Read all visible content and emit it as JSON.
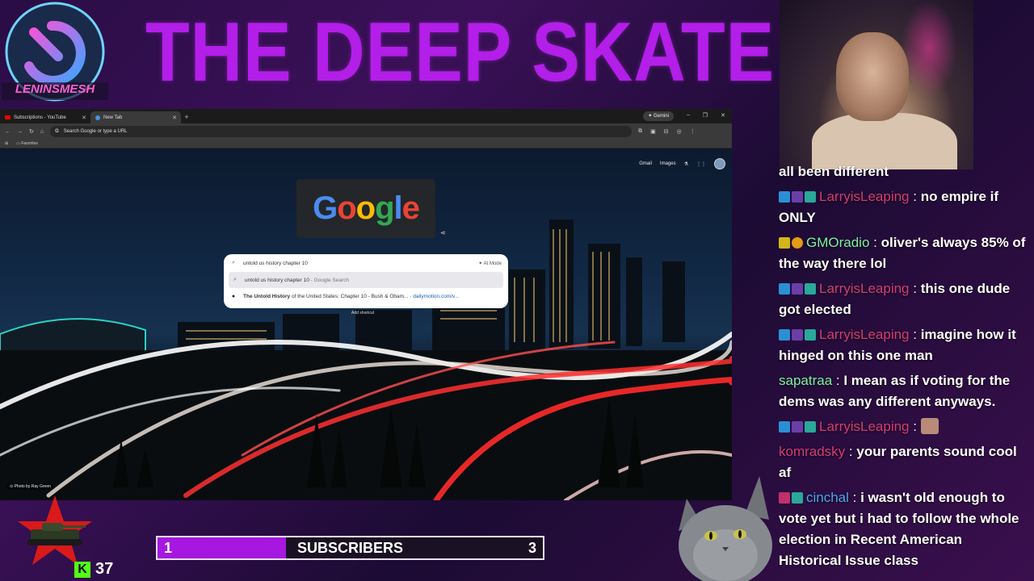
{
  "overlay": {
    "logo_text": "LENINSMESH",
    "stream_title": "THE DEEP SKATE",
    "kick_icon": "K",
    "kick_count": "37",
    "subscribers": {
      "current": "1",
      "label": "SUBSCRIBERS",
      "goal": "3",
      "progress_fraction": 0.333,
      "fill_color": "#a617e0"
    },
    "accent_color": "#b31ee8"
  },
  "browser": {
    "tabs": [
      {
        "label": "Subscriptions - YouTube",
        "favicon_color": "#ff0000",
        "active": false
      },
      {
        "label": "New Tab",
        "favicon_color": "#4a90e2",
        "active": true
      }
    ],
    "new_tab_glyph": "+",
    "gemini_label": "Gemini",
    "window_controls": {
      "minimize": "–",
      "maximize": "❐",
      "close": "✕"
    },
    "nav": {
      "back": "←",
      "forward": "→",
      "reload": "↻",
      "home": "⌂"
    },
    "omnibox_placeholder": "Search Google or type a URL",
    "bookmarks": {
      "apps_glyph": "⊞",
      "favorites": "Favorites"
    }
  },
  "ntp": {
    "links": {
      "gmail": "Gmail",
      "images": "Images"
    },
    "doodle_text": "Google",
    "search": {
      "query": "untold us history chapter 10",
      "ai_mode": "AI Mode",
      "suggestion_query": "untold us history chapter 10",
      "suggestion_suffix": "Google Search",
      "result_title_bold": "The Untold History",
      "result_title_rest": "of the United States: Chapter 10 - Bush & Obam...",
      "result_url": "dailymotion.com/v..."
    },
    "add_shortcut": "Add shortcut",
    "photo_credit": "Photo by Ray Green"
  },
  "chat": {
    "messages": [
      {
        "user": "",
        "user_color": "#ffffff",
        "text": "all been different",
        "badges": []
      },
      {
        "user": "LarryisLeaping",
        "user_color": "#d63c74",
        "text": "no empire if ONLY",
        "badges": [
          "blue",
          "purple",
          "teal"
        ]
      },
      {
        "user": "GMOradio",
        "user_color": "#7ef0a0",
        "text": "oliver's always 85% of the way there lol",
        "badges": [
          "gold",
          "orange"
        ]
      },
      {
        "user": "LarryisLeaping",
        "user_color": "#d63c74",
        "text": "this one dude got elected",
        "badges": [
          "blue",
          "purple",
          "teal"
        ]
      },
      {
        "user": "LarryisLeaping",
        "user_color": "#d63c74",
        "text": "imagine how it hinged on this one man",
        "badges": [
          "blue",
          "purple",
          "teal"
        ]
      },
      {
        "user": "sapatraa",
        "user_color": "#7ef0a0",
        "text": "I mean as if voting for the dems was any different anyways.",
        "badges": []
      },
      {
        "user": "LarryisLeaping",
        "user_color": "#d63c74",
        "text": "",
        "badges": [
          "blue",
          "purple",
          "teal"
        ],
        "emote": true
      },
      {
        "user": "komradsky",
        "user_color": "#d63c74",
        "text": "your parents sound cool af",
        "badges": []
      },
      {
        "user": "cinchal",
        "user_color": "#4aa8e8",
        "text": "i wasn't old enough to vote yet but i had to follow the whole election in Recent American Historical Issue class",
        "badges": [
          "pink",
          "teal"
        ]
      }
    ]
  }
}
